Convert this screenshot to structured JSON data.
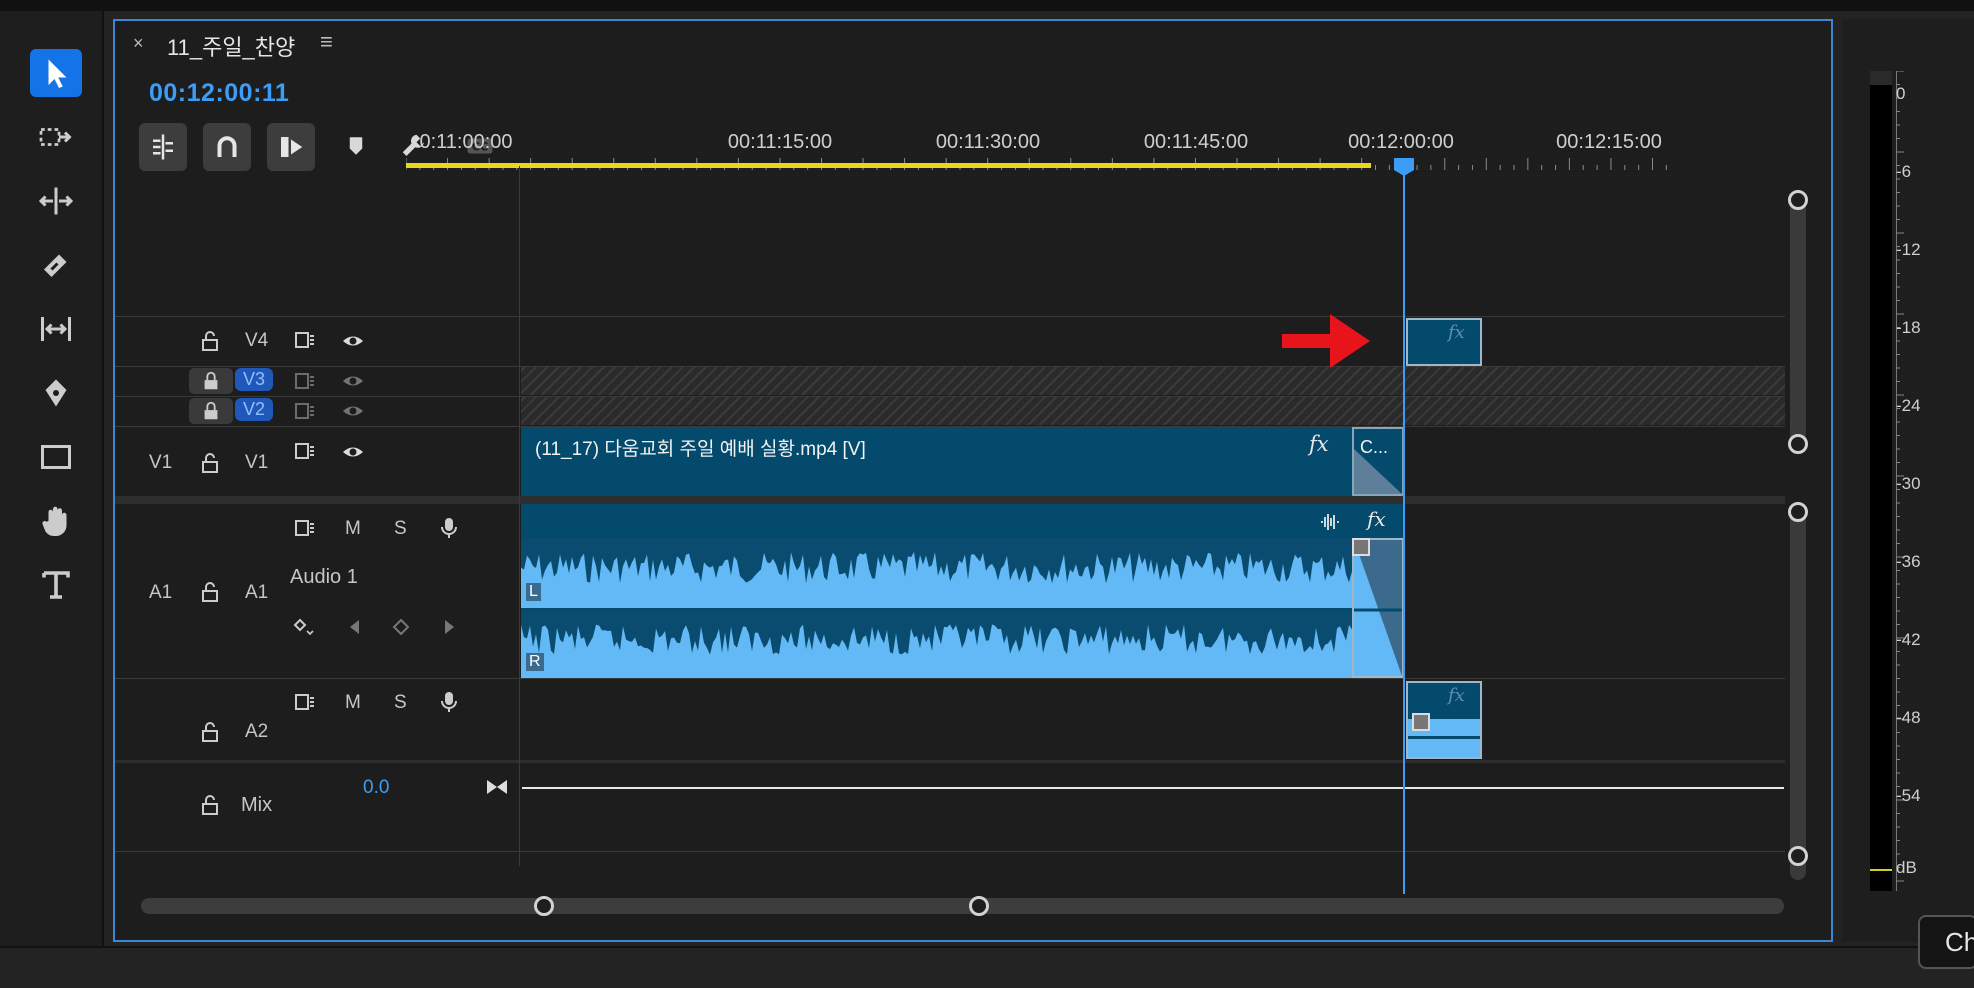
{
  "sequence": {
    "close_label": "×",
    "title": "11_주일_찬양",
    "menu_label": "≡"
  },
  "timecode": "00:12:00:11",
  "ruler": {
    "labels": [
      "0:11:00:00",
      "00:11:15:00",
      "00:11:30:00",
      "00:11:45:00",
      "00:12:00:00",
      "00:12:15:00",
      "00"
    ]
  },
  "tracks": {
    "v4": {
      "label": "V4"
    },
    "v3": {
      "label": "V3"
    },
    "v2": {
      "label": "V2"
    },
    "v1": {
      "source": "V1",
      "label": "V1"
    },
    "a1": {
      "source": "A1",
      "label": "A1",
      "name": "Audio 1",
      "mute": "M",
      "solo": "S"
    },
    "a2": {
      "label": "A2",
      "mute": "M",
      "solo": "S"
    },
    "mix": {
      "label": "Mix",
      "value": "0.0"
    }
  },
  "clips": {
    "video_name": "(11_17) 다움교회 주일 예배 실황.mp4 [V]",
    "video_fx": "fx",
    "transition_label": "C...",
    "audio_fx": "fx",
    "audio_left": "L",
    "audio_right": "R",
    "small_fx_v4": "fx",
    "small_fx_a2": "fx"
  },
  "meter": {
    "labels": [
      "0",
      "-6",
      "-12",
      "-18",
      "-24",
      "-30",
      "-36",
      "-42",
      "-48",
      "-54",
      "dB"
    ]
  },
  "chip": {
    "label": "Ch"
  },
  "colors": {
    "accent": "#3d9df6",
    "clip_video": "#044a6d",
    "clip_audio": "#63b9f5",
    "work_area": "#e8d81c",
    "arrow": "#e8141c"
  }
}
